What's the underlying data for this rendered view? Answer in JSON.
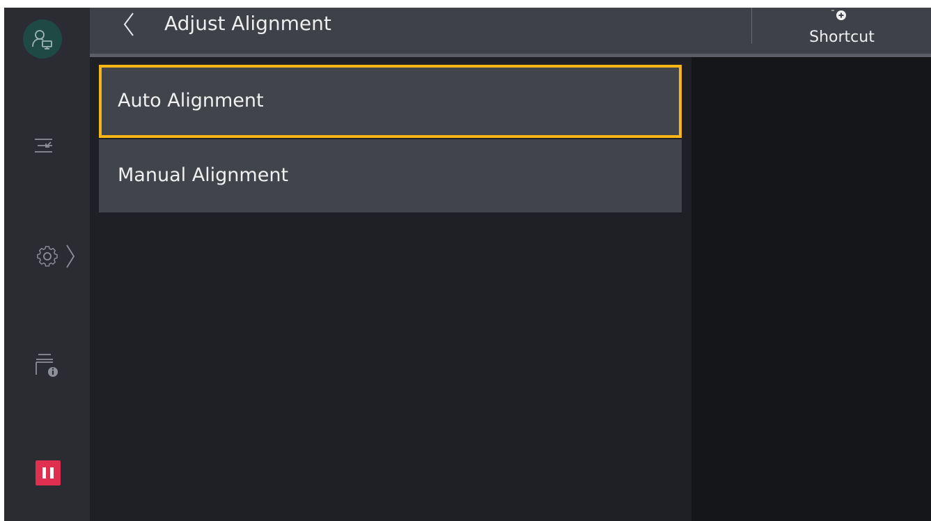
{
  "header": {
    "title": "Adjust Alignment",
    "back_icon": "chevron-left-icon",
    "shortcut_label": "Shortcut",
    "shortcut_icon": "add-shortcut-icon"
  },
  "sidebar": {
    "items": [
      {
        "icon": "user-device-icon"
      },
      {
        "icon": "transfer-icon"
      },
      {
        "icon": "gear-icon"
      },
      {
        "icon": "device-info-icon"
      },
      {
        "icon": "pause-icon"
      }
    ]
  },
  "menu": {
    "items": [
      {
        "label": "Auto Alignment",
        "selected": true
      },
      {
        "label": "Manual Alignment",
        "selected": false
      }
    ]
  },
  "colors": {
    "background": "#18191c",
    "sidebar": "#2a2c31",
    "header": "#3f4149",
    "item": "#42444c",
    "selection_border": "#f6b716",
    "pause_button": "#e0304f",
    "avatar": "#1f4a44"
  }
}
